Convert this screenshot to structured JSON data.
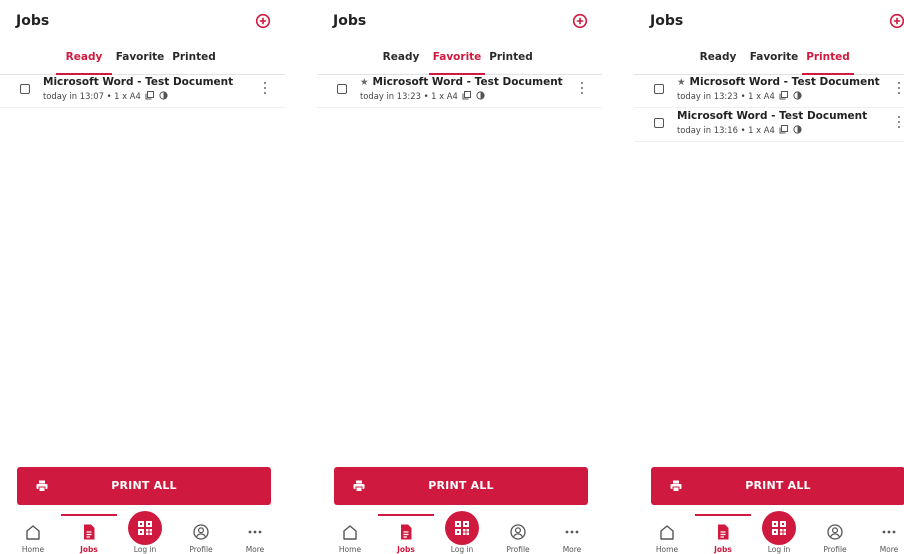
{
  "colors": {
    "accent": "#d0193f",
    "text": "#222222"
  },
  "screens": [
    {
      "title": "Jobs",
      "tabs": [
        "Ready",
        "Favorite",
        "Printed"
      ],
      "active_tab": "Ready",
      "jobs": [
        {
          "title": "Microsoft Word - Test Document",
          "favorite": false,
          "meta": "today in 13:07 • 1 x A4"
        }
      ],
      "print_all": "PRINT ALL",
      "nav": [
        "Home",
        "Jobs",
        "Log in",
        "Profile",
        "More"
      ]
    },
    {
      "title": "Jobs",
      "tabs": [
        "Ready",
        "Favorite",
        "Printed"
      ],
      "active_tab": "Favorite",
      "jobs": [
        {
          "title": "Microsoft Word - Test Document",
          "favorite": true,
          "meta": "today in 13:23 • 1 x A4"
        }
      ],
      "print_all": "PRINT ALL",
      "nav": [
        "Home",
        "Jobs",
        "Log in",
        "Profile",
        "More"
      ]
    },
    {
      "title": "Jobs",
      "tabs": [
        "Ready",
        "Favorite",
        "Printed"
      ],
      "active_tab": "Printed",
      "jobs": [
        {
          "title": "Microsoft Word - Test Document",
          "favorite": true,
          "meta": "today in 13:23 • 1 x A4"
        },
        {
          "title": "Microsoft Word - Test Document",
          "favorite": false,
          "meta": "today in 13:16 • 1 x A4"
        }
      ],
      "print_all": "PRINT ALL",
      "nav": [
        "Home",
        "Jobs",
        "Log in",
        "Profile",
        "More"
      ]
    }
  ]
}
